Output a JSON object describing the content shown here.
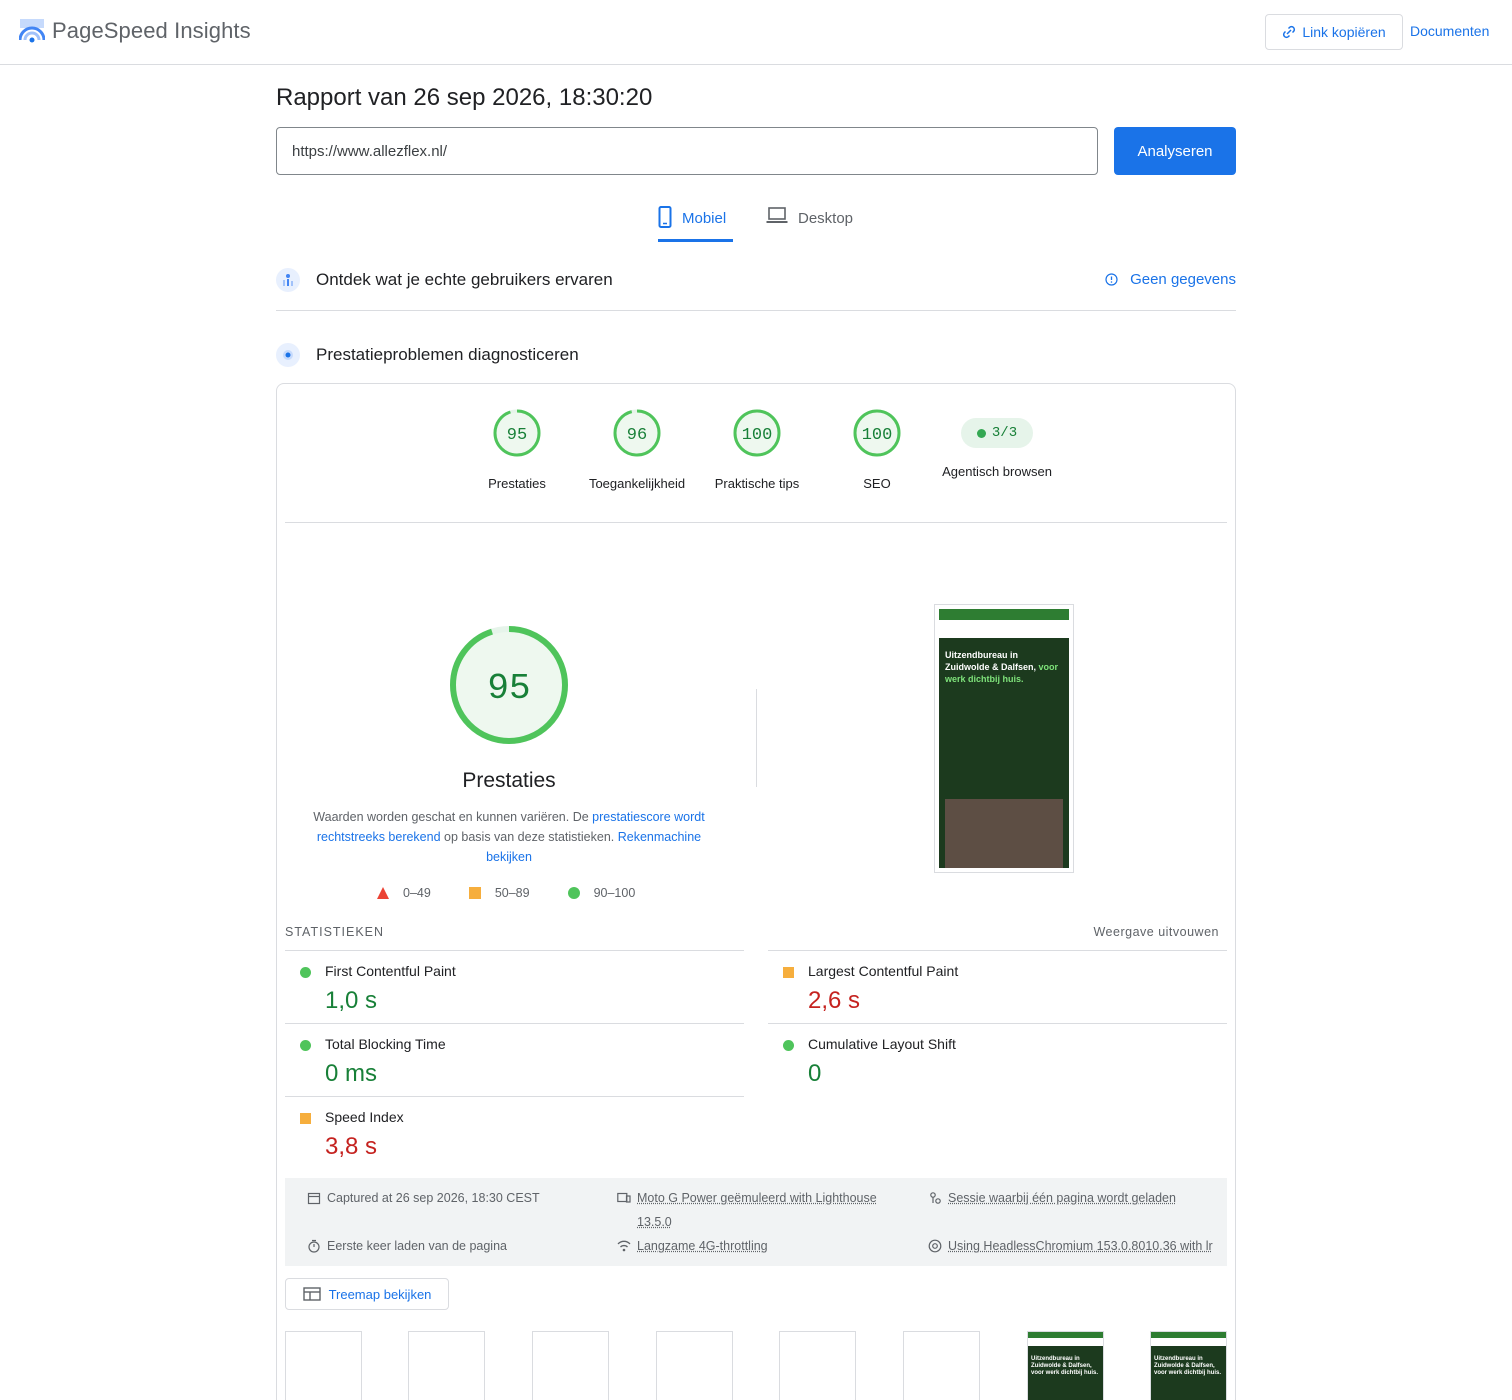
{
  "header": {
    "app_title": "PageSpeed Insights",
    "copy_link_label": "Link kopiëren",
    "docs_label": "Documenten"
  },
  "report": {
    "title": "Rapport van 26 sep 2026, 18:30:20",
    "url_value": "https://www.allezflex.nl/",
    "analyze_label": "Analyseren"
  },
  "tabs": [
    {
      "label": "Mobiel",
      "selected": true
    },
    {
      "label": "Desktop",
      "selected": false
    }
  ],
  "sections": {
    "field": {
      "title": "Ontdek wat je echte gebruikers ervaren",
      "no_data_label": "Geen gegevens"
    },
    "lab": {
      "title": "Prestatieproblemen diagnosticeren"
    }
  },
  "scores": [
    {
      "value": 95,
      "text": "95",
      "label": "Prestaties"
    },
    {
      "value": 96,
      "text": "96",
      "label": "Toegankelijkheid"
    },
    {
      "value": 100,
      "text": "100",
      "label": "Praktische tips"
    },
    {
      "value": 100,
      "text": "100",
      "label": "SEO"
    }
  ],
  "agentic": {
    "pill": "3/3",
    "label": "Agentisch browsen"
  },
  "performance": {
    "score": 95,
    "score_text": "95",
    "label": "Prestaties",
    "desc_1": "Waarden worden geschat en kunnen variëren. De ",
    "desc_link_1": "prestatiescore wordt rechtstreeks berekend",
    "desc_2": " op basis van deze statistieken. ",
    "desc_link_2": "Rekenmachine bekijken"
  },
  "legend": {
    "bad": "0–49",
    "avg": "50–89",
    "good": "90–100"
  },
  "screenshot": {
    "headline_1": "Uitzendbureau in Zuidwolde & Dalfsen,",
    "headline_2": "voor werk dichtbij huis."
  },
  "stats": {
    "header": "STATISTIEKEN",
    "expand_label": "Weergave uitvouwen",
    "metrics": [
      {
        "name": "First Contentful Paint",
        "value": "1,0 s",
        "rating": "good"
      },
      {
        "name": "Largest Contentful Paint",
        "value": "2,6 s",
        "rating": "average"
      },
      {
        "name": "Total Blocking Time",
        "value": "0 ms",
        "rating": "good"
      },
      {
        "name": "Cumulative Layout Shift",
        "value": "0",
        "rating": "good"
      },
      {
        "name": "Speed Index",
        "value": "3,8 s",
        "rating": "average"
      }
    ]
  },
  "environment": {
    "captured": "Captured at 26 sep 2026, 18:30 CEST",
    "device_1": "Moto G Power geëmuleerd with Lighthouse",
    "device_2": "13.5.0",
    "session": "Sessie waarbij één pagina wordt geladen",
    "load": "Eerste keer laden van de pagina",
    "throttling": "Langzame 4G-throttling",
    "browser": "Using HeadlessChromium 153.0.8010.36 with lr"
  },
  "treemap_label": "Treemap bekijken",
  "filmstrip": {
    "thumb_text_1": "Uitzendbureau in Zuidwolde & Dalfsen,",
    "thumb_text_2": "voor werk dichtbij huis."
  },
  "colors": {
    "accent": "#1a73e8",
    "good": "#0cce6b",
    "good_text": "#188038",
    "average": "#ffa400",
    "bad": "#ff4e42"
  }
}
